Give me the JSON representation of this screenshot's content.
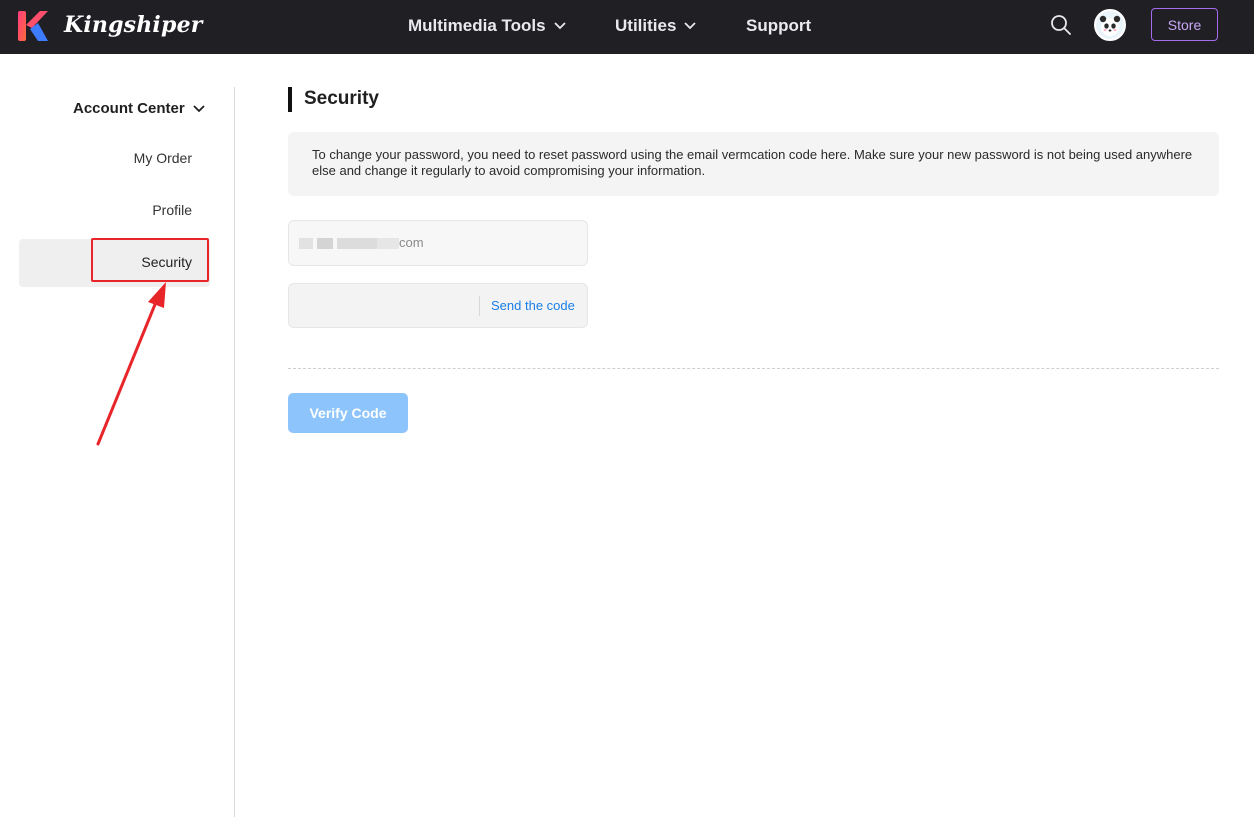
{
  "header": {
    "brand": "Kingshiper",
    "nav": [
      {
        "label": "Multimedia Tools",
        "icon": "chevron-down-icon"
      },
      {
        "label": "Utilities",
        "icon": "chevron-down-icon"
      },
      {
        "label": "Support"
      }
    ],
    "store_label": "Store",
    "search_icon": "search-icon",
    "avatar_icon": "panda-avatar-icon",
    "colors": {
      "bar": "#1f1f24",
      "store_border": "#a56cf0"
    }
  },
  "sidebar": {
    "group_label": "Account Center",
    "items": [
      {
        "label": "My Order"
      },
      {
        "label": "Profile"
      },
      {
        "label": "Security",
        "active": true
      }
    ]
  },
  "main": {
    "title": "Security",
    "notice": "To change your password, you need to reset password using the email vermcation code here. Make sure your new password is not being used anywhere else and change it regularly to avoid compromising your information.",
    "email_suffix": "com",
    "send_code_label": "Send the code",
    "verify_label": "Verify Code",
    "colors": {
      "link": "#1a7ee6",
      "verify_bg": "#8dc4fb",
      "annotation": "#e8262a"
    }
  }
}
